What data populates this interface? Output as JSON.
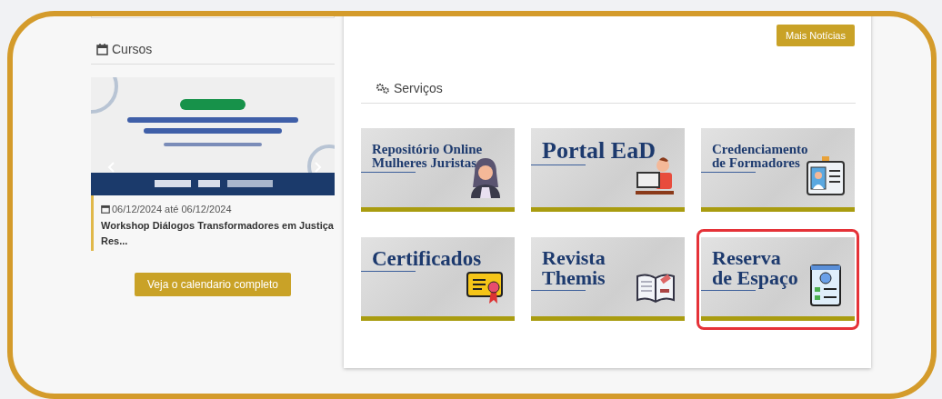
{
  "courses": {
    "heading": "Cursos",
    "event": {
      "dates": "06/12/2024 até 06/12/2024",
      "title": "Workshop Diálogos Transformadores em Justiça Res..."
    },
    "calendar_button": "Veja o calendario completo"
  },
  "news": {
    "more_button": "Mais Notícias"
  },
  "services": {
    "heading": "Serviços",
    "tiles": [
      {
        "kind": "person",
        "title_lines": [
          "Repositório Online",
          "Mulheres Juristas"
        ],
        "highlighted": false
      },
      {
        "kind": "computer",
        "title_lines": [
          "Portal EaD"
        ],
        "highlighted": false
      },
      {
        "kind": "badge",
        "title_lines": [
          "Credenciamento",
          "de Formadores"
        ],
        "highlighted": false
      },
      {
        "kind": "certificate",
        "title_lines": [
          "Certificados"
        ],
        "highlighted": false
      },
      {
        "kind": "book",
        "title_lines": [
          "Revista",
          "Themis"
        ],
        "highlighted": false
      },
      {
        "kind": "form",
        "title_lines": [
          "Reserva",
          "de Espaço"
        ],
        "highlighted": true
      }
    ]
  }
}
